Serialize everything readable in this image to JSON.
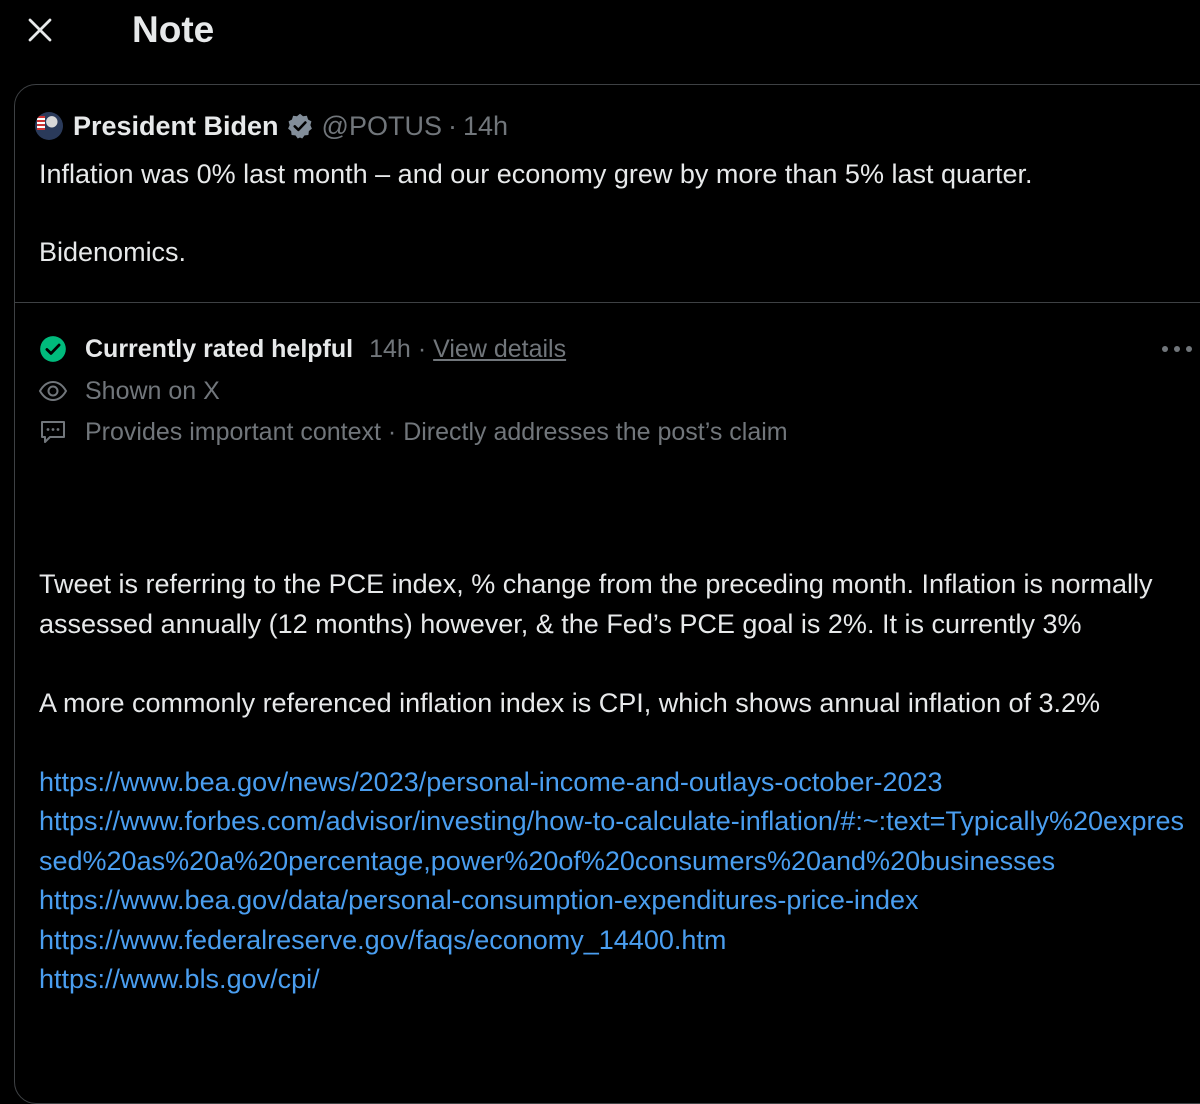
{
  "header": {
    "title": "Note",
    "close_icon": "close-icon"
  },
  "quoted_post": {
    "author_name": "President Biden",
    "handle": "@POTUS",
    "separator": "·",
    "time": "14h",
    "verified_icon": "verified-badge-icon",
    "text_line_1": "Inflation was 0% last month – and our economy grew by more than 5% last quarter.",
    "text_line_2": "Bidenomics."
  },
  "note": {
    "status_icon": "check-circle-icon",
    "status": "Currently rated helpful",
    "time": "14h",
    "separator": "·",
    "view_details": "View details",
    "more_icon": "more-options-icon",
    "shown_on": "Shown on X",
    "shown_icon": "eye-icon",
    "tags_icon": "comment-icon",
    "tags": "Provides important context · Directly addresses the post’s claim",
    "paragraph_1": "Tweet is referring to the PCE index, % change from the preceding month. Inflation is normally assessed annually (12 months) however, & the Fed’s PCE goal is 2%. It is currently 3%",
    "paragraph_2": "A more commonly referenced inflation index is CPI, which shows annual inflation of 3.2%",
    "links": [
      "https://www.bea.gov/news/2023/personal-income-and-outlays-october-2023",
      "https://www.forbes.com/advisor/investing/how-to-calculate-inflation/#:~:text=Typically%20expressed%20as%20a%20percentage,power%20of%20consumers%20and%20businesses",
      "https://www.bea.gov/data/personal-consumption-expenditures-price-index",
      "https://www.federalreserve.gov/faqs/economy_14400.htm",
      "https://www.bls.gov/cpi/"
    ]
  },
  "colors": {
    "background": "#000000",
    "text": "#e7e9ea",
    "muted": "#71767b",
    "link": "#4a9ef0",
    "helpful_green": "#00ba7c",
    "verified_fill": "#828d99",
    "border": "#3e4144"
  }
}
